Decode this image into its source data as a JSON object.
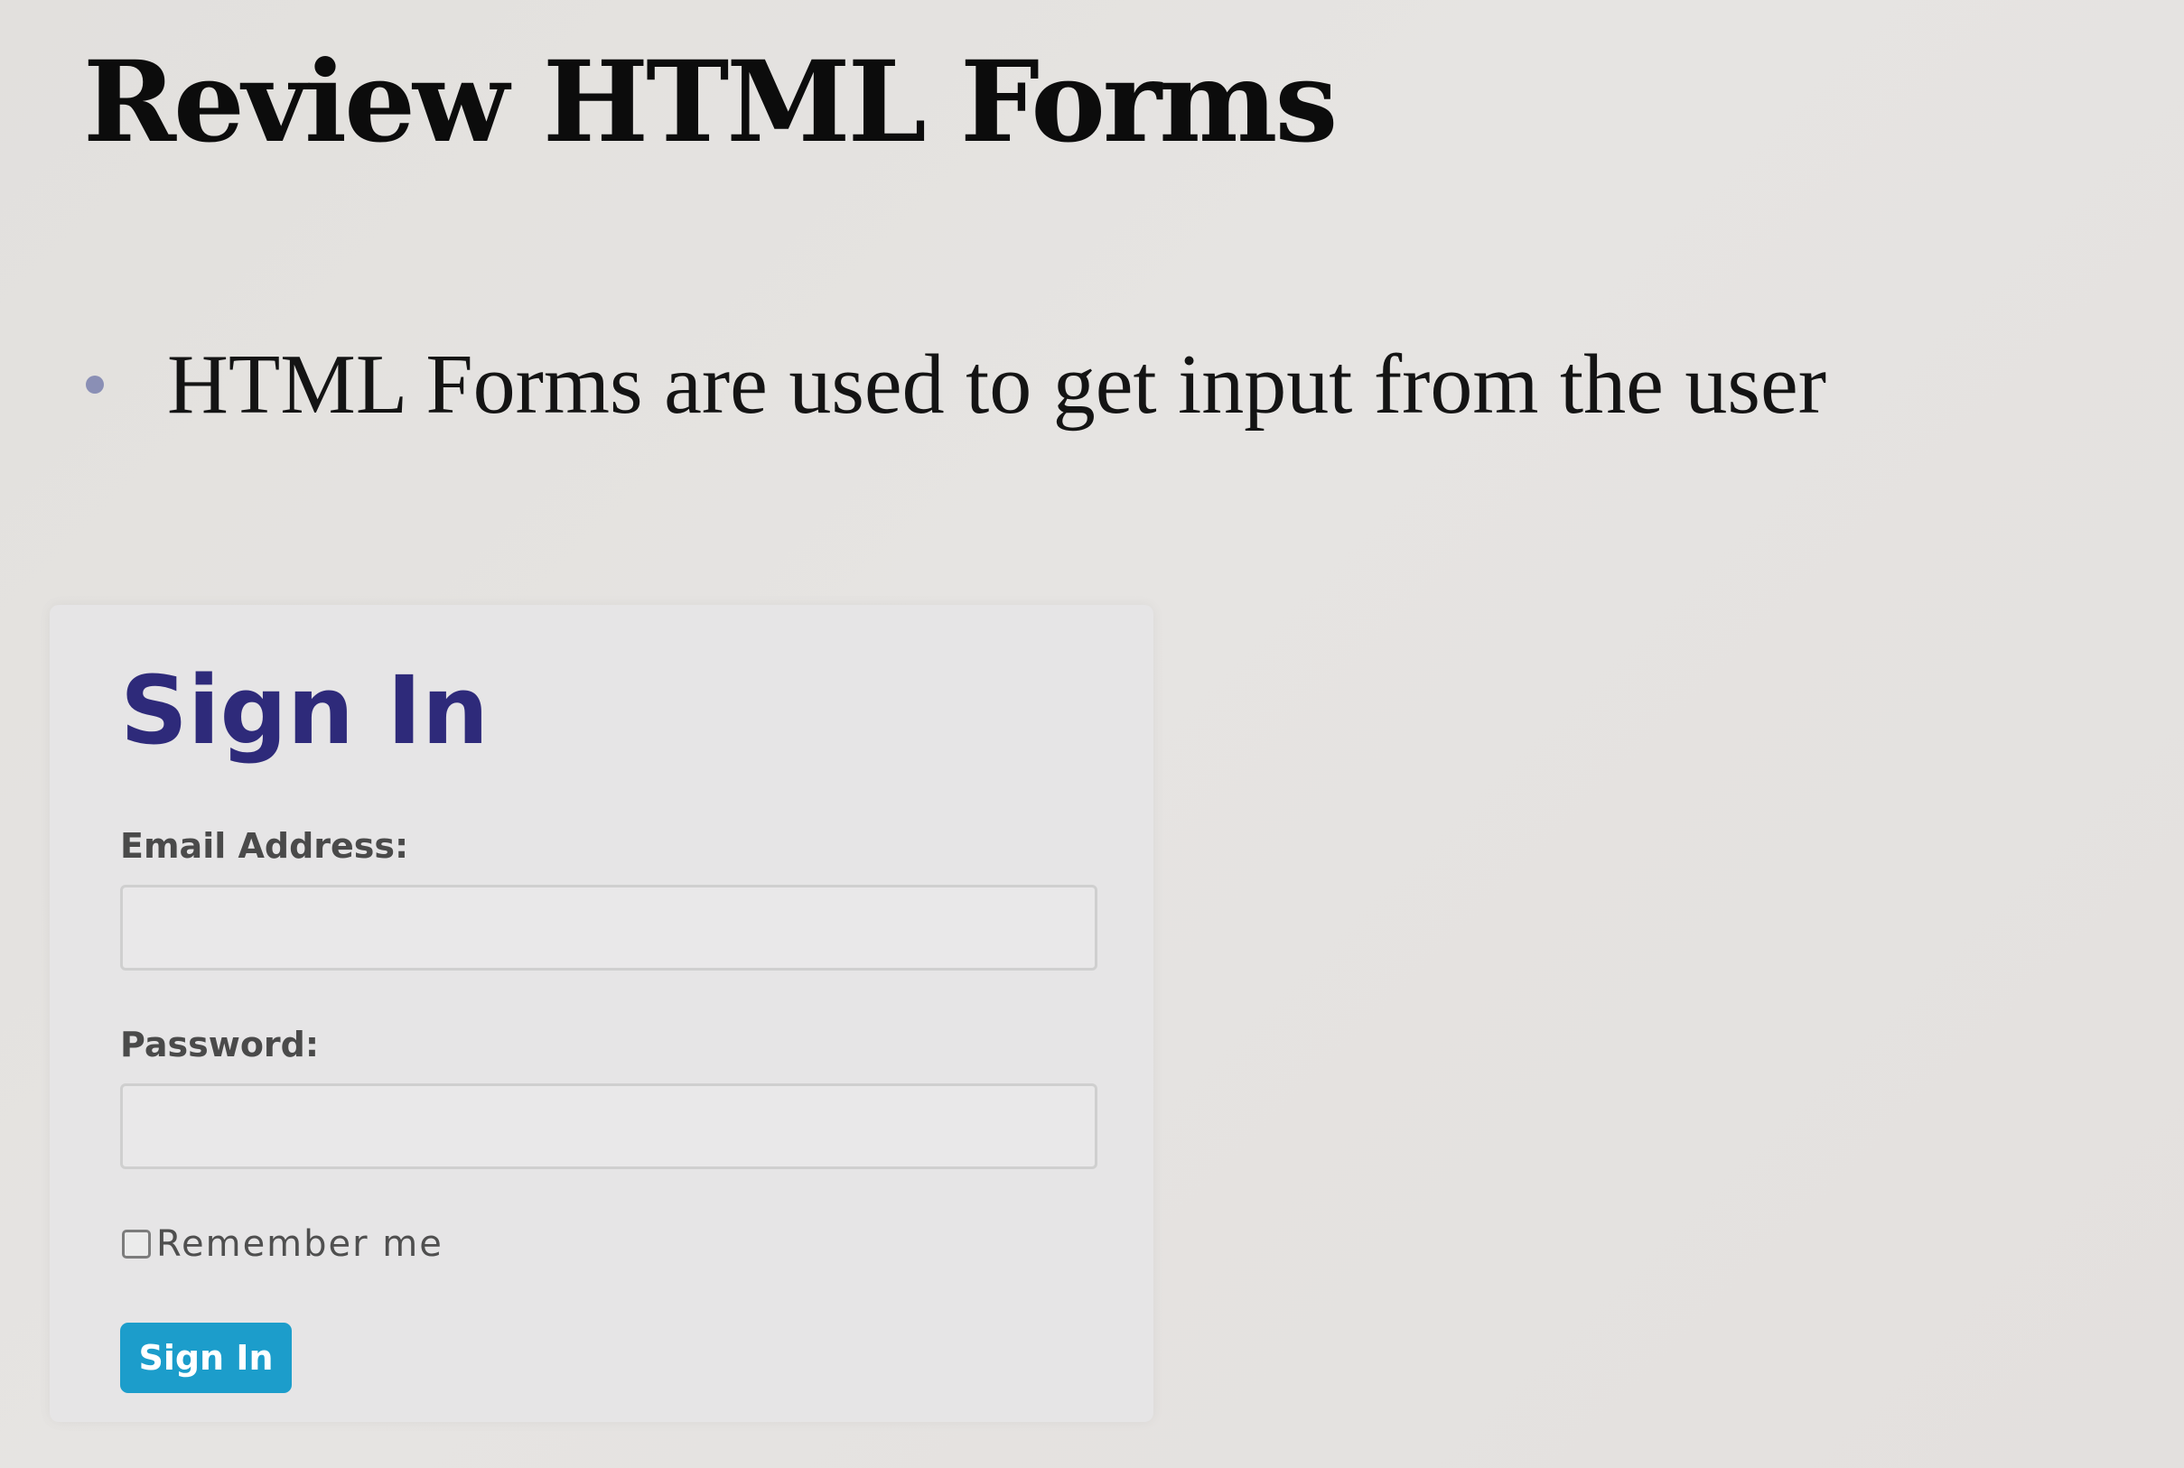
{
  "slide": {
    "title": "Review HTML Forms",
    "bullets": [
      "HTML Forms are used to get input from the user"
    ]
  },
  "form": {
    "title": "Sign In",
    "email_label": "Email Address:",
    "email_value": "",
    "password_label": "Password:",
    "password_value": "",
    "remember_label": "Remember me",
    "remember_checked": false,
    "submit_label": "Sign In"
  },
  "colors": {
    "form_title": "#2e2a7a",
    "button": "#1c9dcb",
    "bullet": "#8a8fb5"
  }
}
